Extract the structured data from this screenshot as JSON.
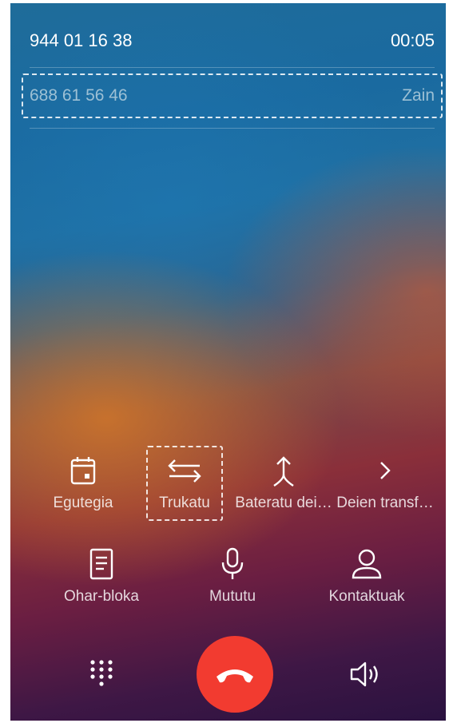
{
  "call": {
    "active_number": "944 01 16 38",
    "duration": "00:05",
    "held_number": "688 61 56 46",
    "held_status": "Zain"
  },
  "actions_row1": [
    {
      "label": "Egutegia",
      "icon": "calendar-icon"
    },
    {
      "label": "Trukatu",
      "icon": "swap-icon"
    },
    {
      "label": "Bateratu dei…",
      "icon": "merge-icon"
    },
    {
      "label": "Deien transf…",
      "icon": "chevron-right-icon"
    }
  ],
  "actions_row2": [
    {
      "label": "Ohar-bloka",
      "icon": "note-icon"
    },
    {
      "label": "Mututu",
      "icon": "microphone-icon"
    },
    {
      "label": "Kontaktuak",
      "icon": "contact-icon"
    }
  ],
  "bottom": {
    "dialpad_icon": "dialpad-icon",
    "end_call_icon": "hangup-icon",
    "speaker_icon": "speaker-icon",
    "end_call_color": "#f23b30"
  }
}
